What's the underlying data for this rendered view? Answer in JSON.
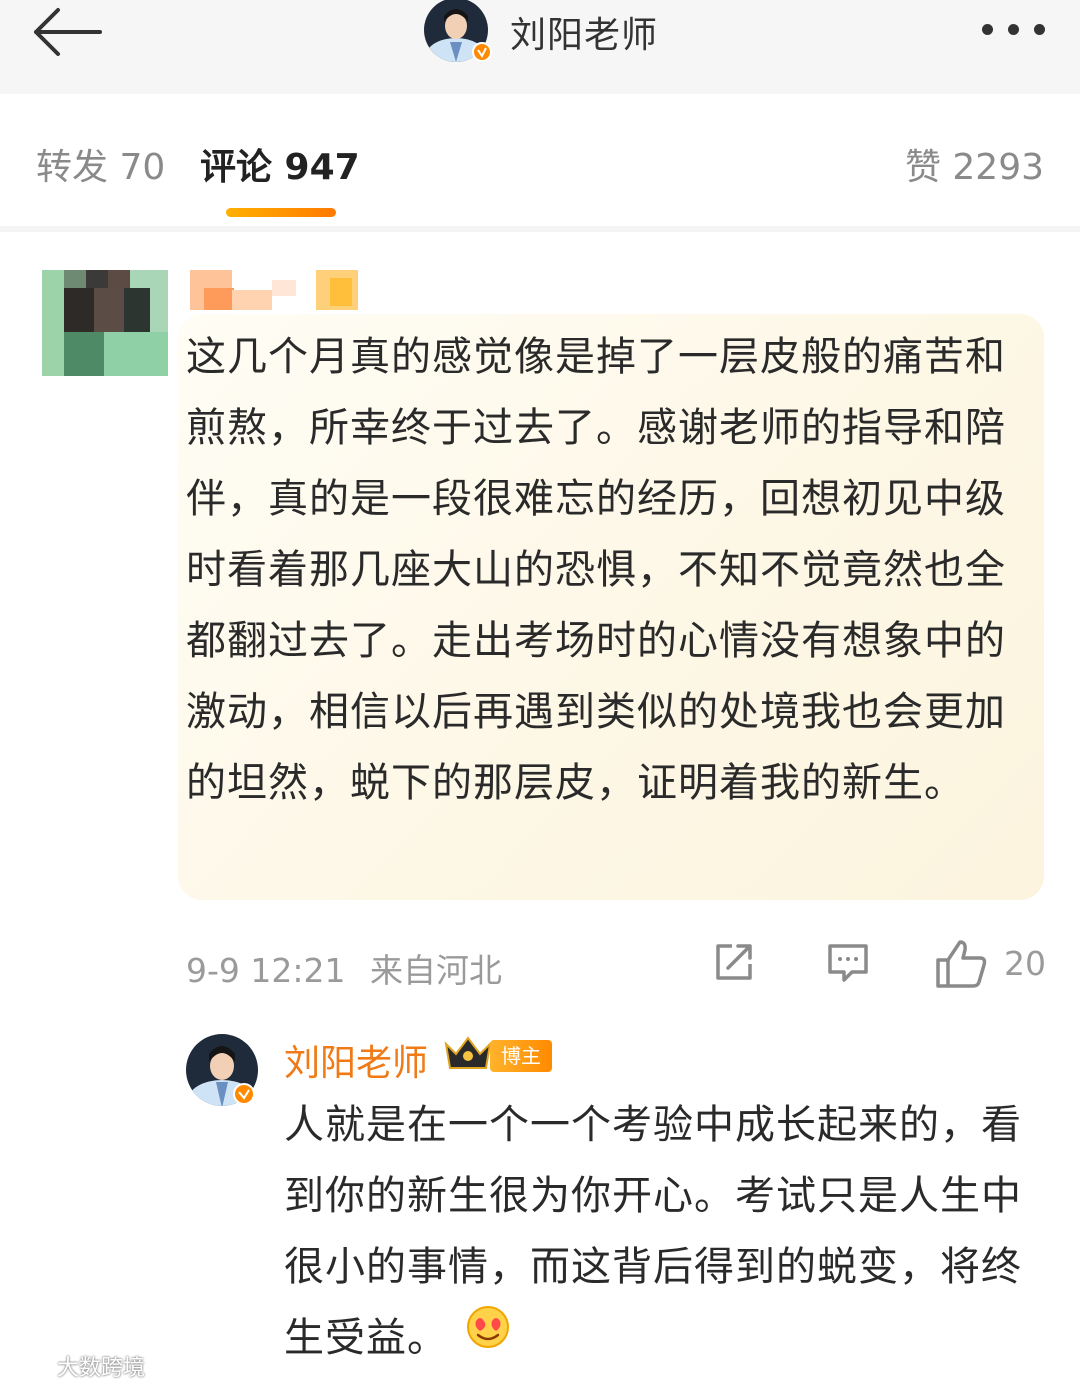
{
  "header": {
    "title": "刘阳老师",
    "back_icon": "arrow-left-icon",
    "more_icon": "more-dots-icon"
  },
  "tabs": {
    "repost": "转发 70",
    "comment": "评论 947",
    "like": "赞 2293",
    "accent": "#ff8a00"
  },
  "comment": {
    "text": "这几个月真的感觉像是掉了一层皮般的痛苦和煎熬，所幸终于过去了。感谢老师的指导和陪伴，真的是一段很难忘的经历，回想初见中级时看着那几座大山的恐惧，不知不觉竟然也全都翻过去了。走出考场时的心情没有想象中的激动，相信以后再遇到类似的处境我也会更加的坦然，蜕下的那层皮，证明着我的新生。",
    "time": "9-9 12:21",
    "location": "来自河北",
    "likes": "20",
    "bubble_color": "#fdf7e6"
  },
  "reply": {
    "name": "刘阳老师",
    "badge": "博主",
    "text": "人就是在一个一个考验中成长起来的，看到你的新生很为你开心。考试只是人生中很小的事情，而这背后得到的蜕变，将终生受益。",
    "emoji": "heart-smile-emoji",
    "name_color": "#f07a16"
  },
  "watermark": {
    "text": "大数跨境"
  }
}
